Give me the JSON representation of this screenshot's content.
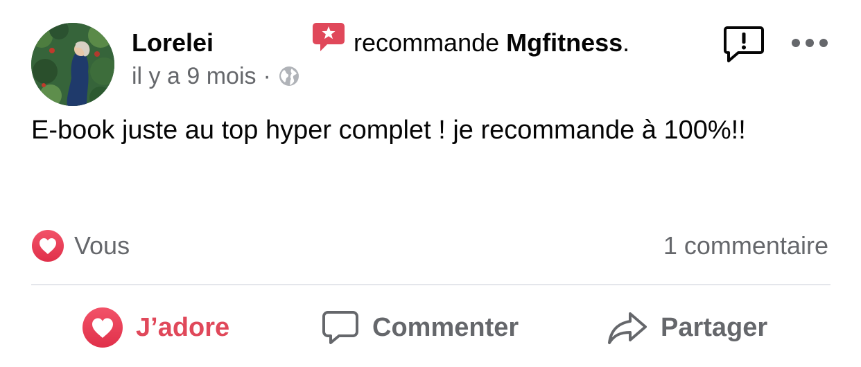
{
  "post": {
    "author": "Lorelei",
    "verb": "recommande",
    "page_name": "Mgfitness",
    "punctuation": ".",
    "time": "il y a 9 mois",
    "separator": "·",
    "privacy_icon": "globe-icon",
    "body": "E-book juste au top hyper complet ! je recommande à 100%!!"
  },
  "stats": {
    "reaction_icon": "heart-icon",
    "reaction_label": "Vous",
    "comments": "1 commentaire"
  },
  "actions": {
    "like_label": "J’adore",
    "comment_label": "Commenter",
    "share_label": "Partager"
  },
  "colors": {
    "love_red": "#e0485a",
    "secondary_text": "#65676b",
    "divider": "#e4e6eb"
  }
}
